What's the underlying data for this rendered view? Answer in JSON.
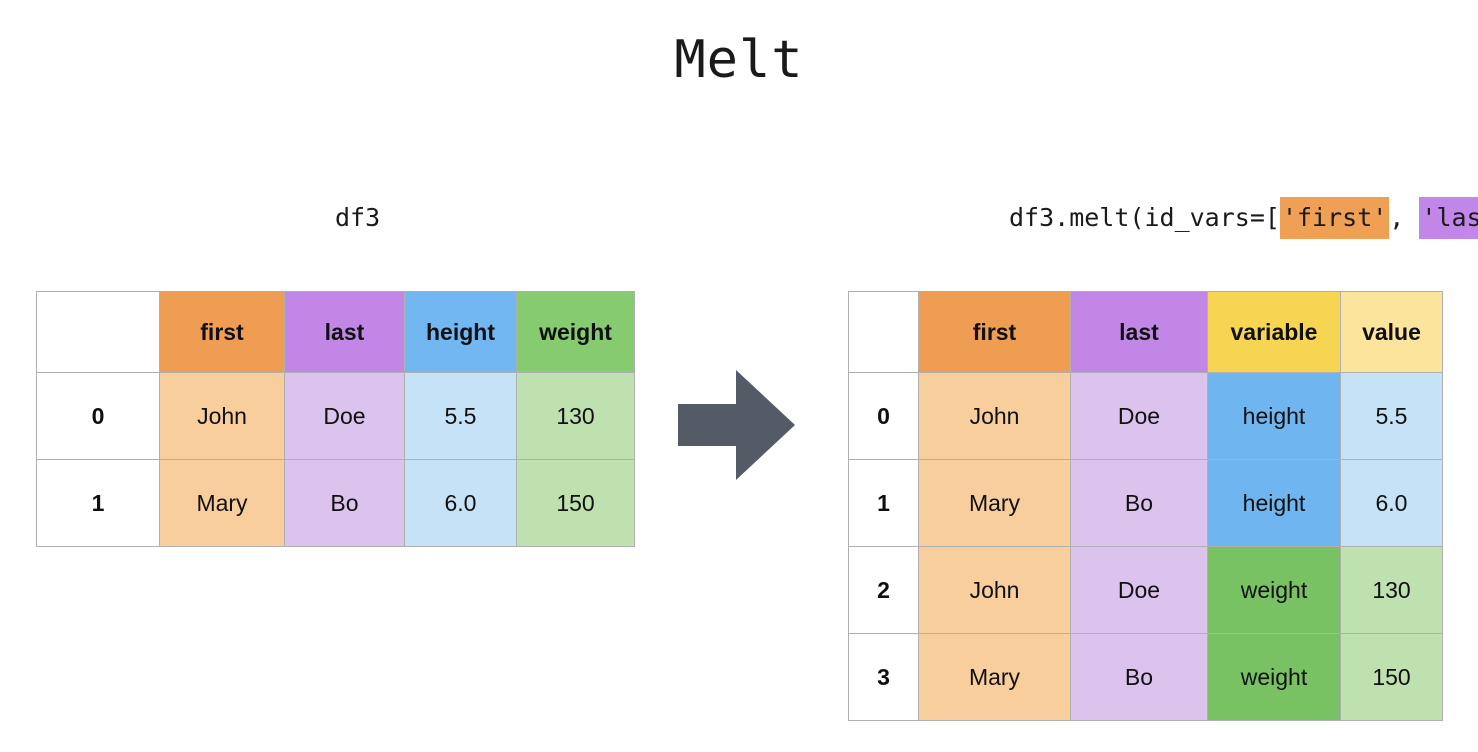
{
  "title": "Melt",
  "arrow": {
    "icon": "right-arrow-icon",
    "color": "#555B66"
  },
  "left_panel": {
    "caption": "df3",
    "table": {
      "index_header": "",
      "headers": [
        "first",
        "last",
        "height",
        "weight"
      ],
      "index": [
        "0",
        "1"
      ],
      "rows": [
        [
          "John",
          "Doe",
          "5.5",
          "130"
        ],
        [
          "Mary",
          "Bo",
          "6.0",
          "150"
        ]
      ]
    }
  },
  "right_panel": {
    "caption_parts": {
      "prefix": "df3.melt(id_vars=[",
      "arg1": "'first'",
      "separator": ", ",
      "arg2": "'last'",
      "suffix": "])"
    },
    "table": {
      "index_header": "",
      "headers": [
        "first",
        "last",
        "variable",
        "value"
      ],
      "index": [
        "0",
        "1",
        "2",
        "3"
      ],
      "rows": [
        [
          "John",
          "Doe",
          "height",
          "5.5"
        ],
        [
          "Mary",
          "Bo",
          "height",
          "6.0"
        ],
        [
          "John",
          "Doe",
          "weight",
          "130"
        ],
        [
          "Mary",
          "Bo",
          "weight",
          "150"
        ]
      ]
    }
  },
  "colors": {
    "first_header": "#EE9D52",
    "last_header": "#C287E6",
    "height_header": "#72B6F2",
    "weight_header": "#87CB70",
    "variable_header": "#F6D552",
    "value_header": "#FBE49B",
    "arrow": "#555B66"
  }
}
